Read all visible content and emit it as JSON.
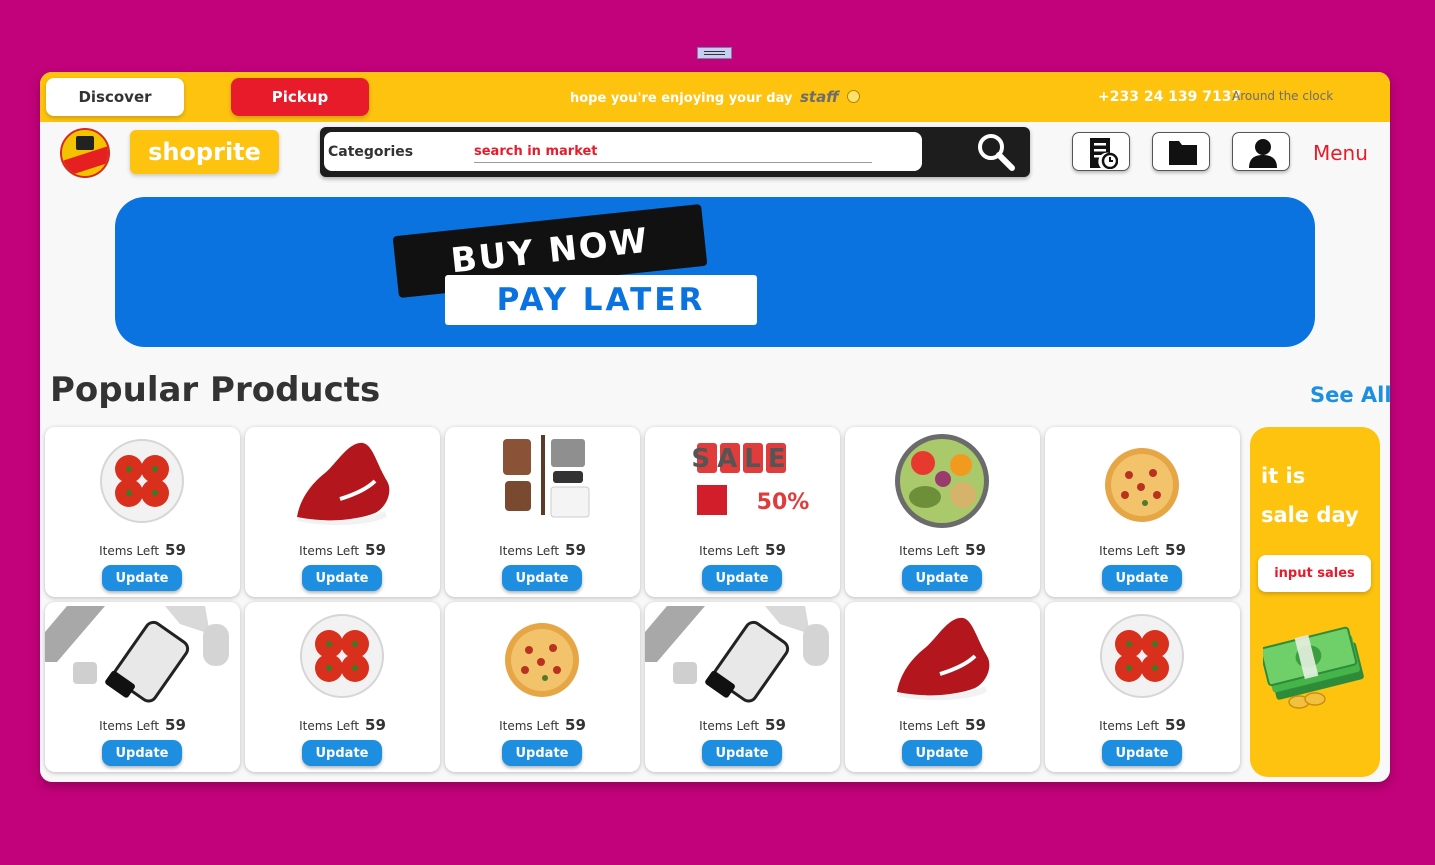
{
  "topbar": {
    "discover_label": "Discover",
    "pickup_label": "Pickup",
    "greeting": "hope you're enjoying your day",
    "greeting_user": "staff",
    "phone": "+233 24 139 7137",
    "availability": "Around the clock"
  },
  "header": {
    "brand": "shoprite",
    "categories_label": "Categories",
    "search_placeholder": "search in market",
    "menu_label": "Menu"
  },
  "banner": {
    "line1": "BUY NOW",
    "line2": "PAY LATER"
  },
  "section": {
    "title": "Popular Products",
    "see_all": "See All"
  },
  "products": [
    {
      "image": "tomatoes",
      "left_label": "Items Left",
      "left_value": "59",
      "button": "Update"
    },
    {
      "image": "red-sneaker",
      "left_label": "Items Left",
      "left_value": "59",
      "button": "Update"
    },
    {
      "image": "clothing-flatlay",
      "left_label": "Items Left",
      "left_value": "59",
      "button": "Update"
    },
    {
      "image": "sale-tags",
      "left_label": "Items Left",
      "left_value": "59",
      "button": "Update",
      "image_text": [
        "SALE",
        "50%"
      ]
    },
    {
      "image": "salad-bowl",
      "left_label": "Items Left",
      "left_value": "59",
      "button": "Update"
    },
    {
      "image": "pizza",
      "left_label": "Items Left",
      "left_value": "59",
      "button": "Update"
    },
    {
      "image": "laptop-phone",
      "left_label": "Items Left",
      "left_value": "59",
      "button": "Update"
    },
    {
      "image": "tomatoes",
      "left_label": "Items Left",
      "left_value": "59",
      "button": "Update"
    },
    {
      "image": "pizza",
      "left_label": "Items Left",
      "left_value": "59",
      "button": "Update"
    },
    {
      "image": "laptop-phone",
      "left_label": "Items Left",
      "left_value": "59",
      "button": "Update"
    },
    {
      "image": "red-sneaker",
      "left_label": "Items Left",
      "left_value": "59",
      "button": "Update"
    },
    {
      "image": "tomatoes",
      "left_label": "Items Left",
      "left_value": "59",
      "button": "Update"
    }
  ],
  "sale_panel": {
    "line1": "it is",
    "line2": "sale day",
    "button": "input sales",
    "image": "cash-stack"
  },
  "colors": {
    "background": "#c2027a",
    "accent_yellow": "#fec30f",
    "accent_red": "#e81b2b",
    "accent_blue": "#1e8fe0",
    "banner_blue": "#0a73e0"
  },
  "icons": [
    "search-icon",
    "order-history-icon",
    "folder-icon",
    "user-icon"
  ]
}
